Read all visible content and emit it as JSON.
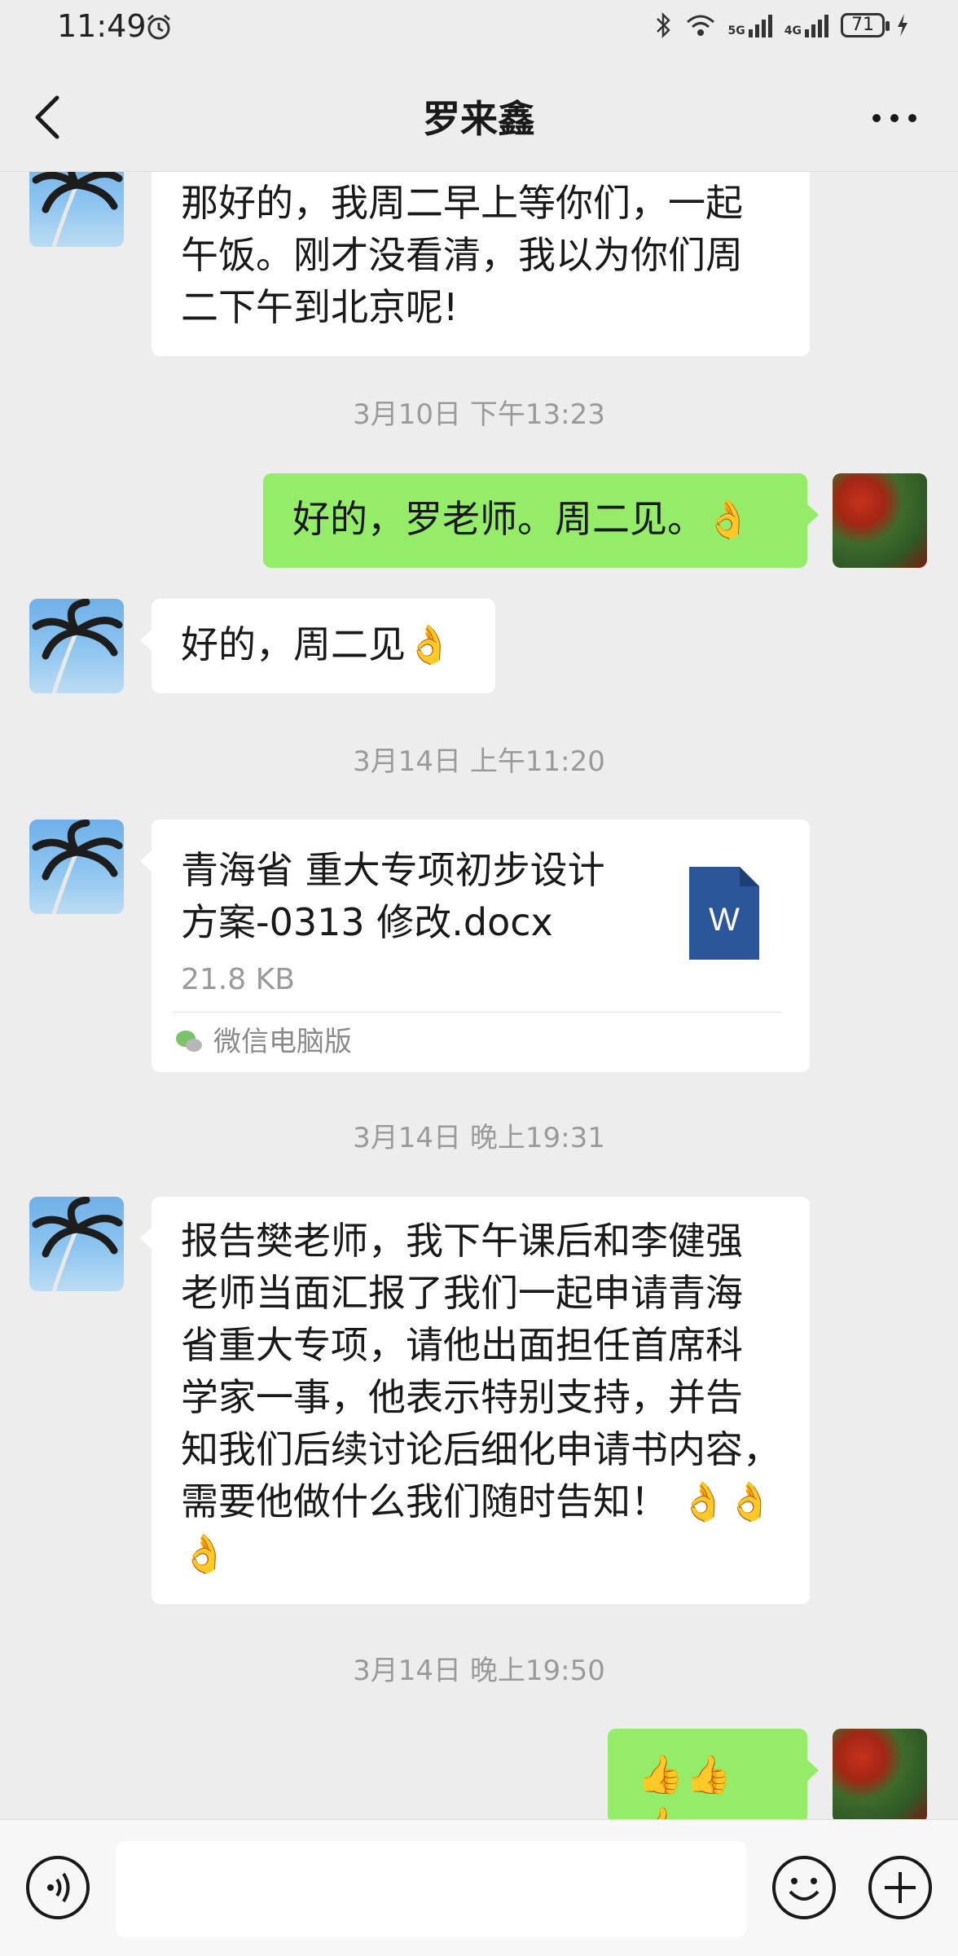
{
  "status_bar": {
    "time": "11:49",
    "network_1": "5G",
    "network_2": "4G",
    "battery": "71"
  },
  "header": {
    "title": "罗来鑫"
  },
  "messages": [
    {
      "type": "text",
      "side": "left",
      "lines": [
        "那好的，我周二早上等你们，一起",
        "午饭。刚才没看清，我以为你们周",
        "二下午到北京呢!"
      ]
    },
    {
      "type": "timestamp",
      "text": "3月10日 下午13:23"
    },
    {
      "type": "text",
      "side": "right",
      "text": "好的，罗老师。周二见。",
      "emoji": "👌"
    },
    {
      "type": "text",
      "side": "left",
      "text": "好的，周二见",
      "emoji": "👌"
    },
    {
      "type": "timestamp",
      "text": "3月14日 上午11:20"
    },
    {
      "type": "file",
      "side": "left",
      "name_line1": "青海省 重大专项初步设计",
      "name_line2": "方案-0313 修改.docx",
      "size": "21.8 KB",
      "source": "微信电脑版",
      "file_icon_letter": "W"
    },
    {
      "type": "timestamp",
      "text": "3月14日 晚上19:31"
    },
    {
      "type": "text",
      "side": "left",
      "lines": [
        "报告樊老师，我下午课后和李健强",
        "老师当面汇报了我们一起申请青海",
        "省重大专项，请他出面担任首席科",
        "学家一事，他表示特别支持，并告",
        "知我们后续讨论后细化申请书内容，",
        "需要他做什么我们随时告知！"
      ],
      "emoji": "👌👌",
      "emoji_line2": "👌"
    },
    {
      "type": "timestamp",
      "text": "3月14日 晚上19:50"
    },
    {
      "type": "text",
      "side": "right",
      "emoji": "👍👍👍"
    }
  ],
  "input": {
    "placeholder": ""
  },
  "colors": {
    "background": "#ededed",
    "my_bubble": "#95ec69",
    "their_bubble": "#ffffff",
    "word_blue": "#2b579a"
  }
}
